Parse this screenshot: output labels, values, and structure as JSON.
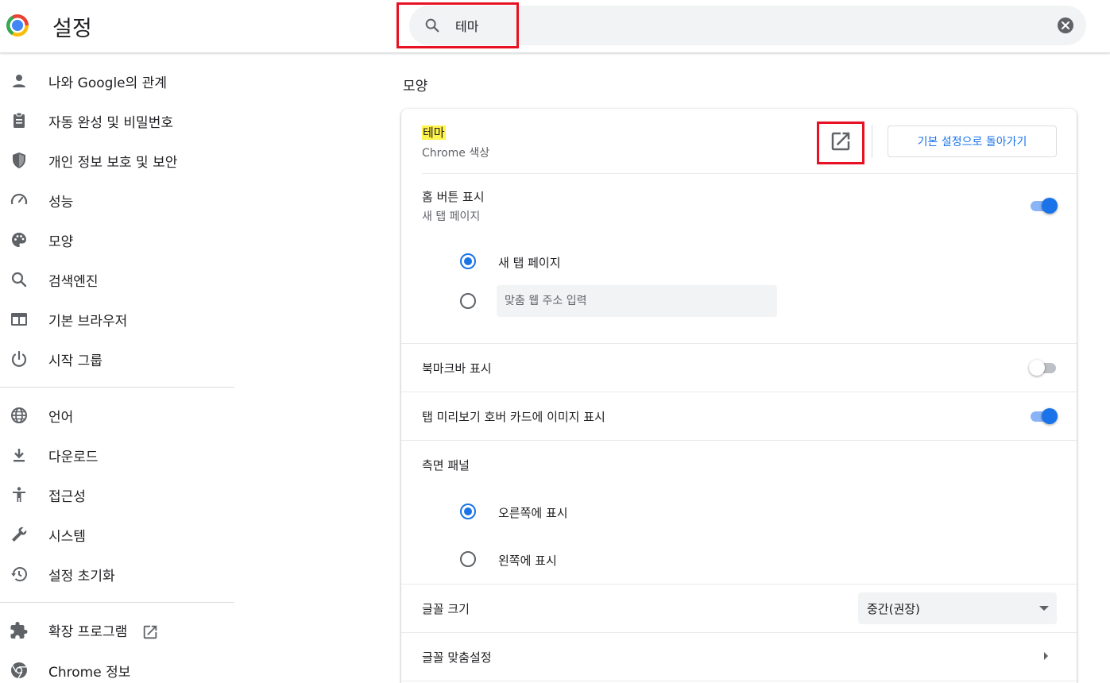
{
  "header": {
    "title": "설정",
    "search_value": "테마",
    "logo_icon": "chrome-logo",
    "search_icon": "search-icon",
    "clear_icon": "close-icon"
  },
  "sidebar": {
    "items": [
      {
        "label": "나와 Google의 관계",
        "icon": "person-icon"
      },
      {
        "label": "자동 완성 및 비밀번호",
        "icon": "clipboard-icon"
      },
      {
        "label": "개인 정보 보호 및 보안",
        "icon": "shield-icon"
      },
      {
        "label": "성능",
        "icon": "speedometer-icon"
      },
      {
        "label": "모양",
        "icon": "palette-icon"
      },
      {
        "label": "검색엔진",
        "icon": "search-icon"
      },
      {
        "label": "기본 브라우저",
        "icon": "browser-icon"
      },
      {
        "label": "시작 그룹",
        "icon": "power-icon"
      },
      {
        "label": "언어",
        "icon": "globe-icon"
      },
      {
        "label": "다운로드",
        "icon": "download-icon"
      },
      {
        "label": "접근성",
        "icon": "accessibility-icon"
      },
      {
        "label": "시스템",
        "icon": "wrench-icon"
      },
      {
        "label": "설정 초기화",
        "icon": "history-icon"
      },
      {
        "label": "확장 프로그램",
        "icon": "puzzle-icon"
      },
      {
        "label": "Chrome 정보",
        "icon": "chrome-icon"
      }
    ]
  },
  "main": {
    "section_title": "모양",
    "theme": {
      "title": "테마",
      "subtitle": "Chrome 색상",
      "reset_button": "기본 설정으로 돌아가기"
    },
    "home_button": {
      "title": "홈 버튼 표시",
      "subtitle": "새 탭 페이지",
      "enabled": true,
      "options": [
        {
          "label": "새 탭 페이지",
          "checked": true
        },
        {
          "placeholder": "맞춤 웹 주소 입력",
          "checked": false
        }
      ]
    },
    "bookmarks_bar": {
      "title": "북마크바 표시",
      "enabled": false
    },
    "tab_hover": {
      "title": "탭 미리보기 호버 카드에 이미지 표시",
      "enabled": true
    },
    "side_panel": {
      "title": "측면 패널",
      "options": [
        {
          "label": "오른쪽에 표시",
          "checked": true
        },
        {
          "label": "왼쪽에 표시",
          "checked": false
        }
      ]
    },
    "font_size": {
      "title": "글꼴 크기",
      "value": "중간(권장)"
    },
    "custom_fonts": {
      "title": "글꼴 맞춤설정"
    }
  },
  "colors": {
    "accent": "#1a73e8",
    "highlight": "#fff34d",
    "annotation_box": "#e81123"
  }
}
